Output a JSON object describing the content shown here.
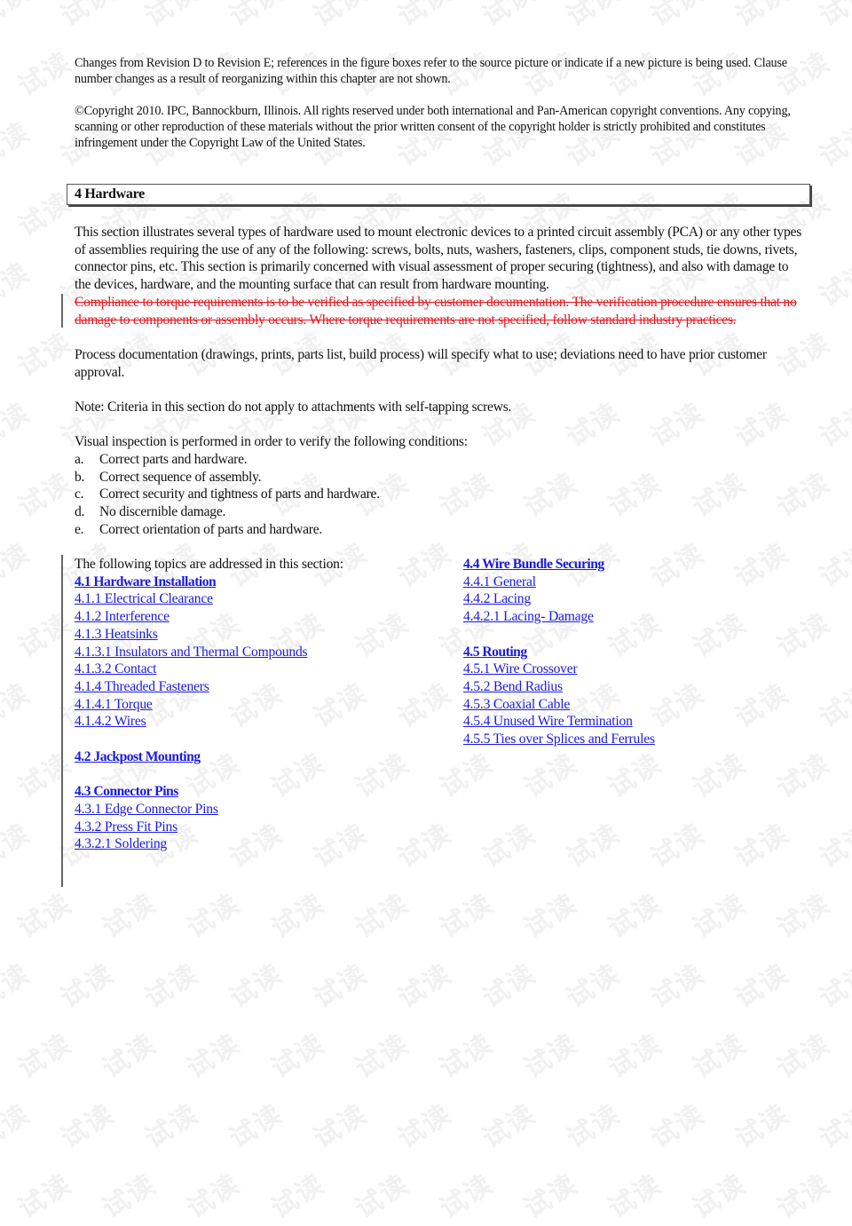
{
  "watermark": "试读",
  "preamble": {
    "revision_note": "Changes from Revision D to Revision E; references in the figure boxes refer to the source picture or indicate if a new picture is being used. Clause number changes as a result of reorganizing within this chapter are not shown.",
    "copyright": "©Copyright 2010. IPC, Bannockburn, Illinois. All rights reserved under both international and Pan-American copyright conventions. Any copying, scanning or other reproduction of these materials without the prior written consent of the copyright holder is strictly prohibited and constitutes infringement under the Copyright Law of the United States."
  },
  "section": {
    "heading": "4 Hardware",
    "intro": "This section illustrates several types of hardware used to mount electronic devices to a printed circuit assembly (PCA) or any other types of assemblies requiring the use of any of the following: screws, bolts, nuts, washers, fasteners, clips, component studs, tie downs, rivets, connector pins, etc. This section is primarily concerned with visual assessment of proper securing (tightness), and also with damage to the devices, hardware, and the mounting surface that can result from hardware mounting.",
    "deleted_text": "Compliance to torque requirements is to be verified as specified by customer documentation. The verification procedure ensures that no damage to components or assembly occurs. Where torque requirements are not specified, follow standard industry practices.",
    "process_doc": "Process documentation (drawings, prints, parts list, build process) will specify what to use; deviations need to have prior customer approval.",
    "note": "Note: Criteria in this section do not apply to attachments with self-tapping screws.",
    "inspection_intro": "Visual inspection is performed in order to verify the following conditions:",
    "conditions": [
      {
        "marker": "a.",
        "text": "Correct parts and hardware."
      },
      {
        "marker": "b.",
        "text": "Correct sequence of assembly."
      },
      {
        "marker": "c.",
        "text": "Correct security and tightness of parts and hardware."
      },
      {
        "marker": "d.",
        "text": "No discernible damage."
      },
      {
        "marker": "e.",
        "text": "Correct orientation of parts and hardware."
      }
    ],
    "topics_intro": "The following topics are addressed in this section:"
  },
  "toc": {
    "left": [
      {
        "label": "4.1 Hardware Installation",
        "major": true
      },
      {
        "label": "4.1.1 Electrical Clearance"
      },
      {
        "label": "4.1.2 Interference"
      },
      {
        "label": "4.1.3 Heatsinks"
      },
      {
        "label": "4.1.3.1 Insulators and Thermal Compounds"
      },
      {
        "label": "4.1.3.2 Contact"
      },
      {
        "label": "4.1.4 Threaded Fasteners"
      },
      {
        "label": "4.1.4.1 Torque"
      },
      {
        "label": "4.1.4.2 Wires"
      },
      {
        "label": "4.2 Jackpost Mounting",
        "major": true
      },
      {
        "label": "4.3 Connector Pins",
        "major": true
      },
      {
        "label": "4.3.1 Edge Connector Pins"
      },
      {
        "label": "4.3.2 Press Fit Pins"
      },
      {
        "label": "4.3.2.1 Soldering"
      }
    ],
    "right": [
      {
        "label": "4.4 Wire Bundle Securing",
        "major": true
      },
      {
        "label": "4.4.1 General"
      },
      {
        "label": "4.4.2 Lacing"
      },
      {
        "label": "4.4.2.1 Lacing- Damage"
      },
      {
        "label": "4.5 Routing",
        "major": true
      },
      {
        "label": "4.5.1 Wire Crossover"
      },
      {
        "label": "4.5.2 Bend Radius"
      },
      {
        "label": "4.5.3 Coaxial Cable"
      },
      {
        "label": "4.5.4 Unused Wire Termination"
      },
      {
        "label": "4.5.5 Ties over Splices and Ferrules"
      }
    ]
  },
  "colors": {
    "link": "#1a1ae0",
    "deleted": "#e8141c"
  }
}
